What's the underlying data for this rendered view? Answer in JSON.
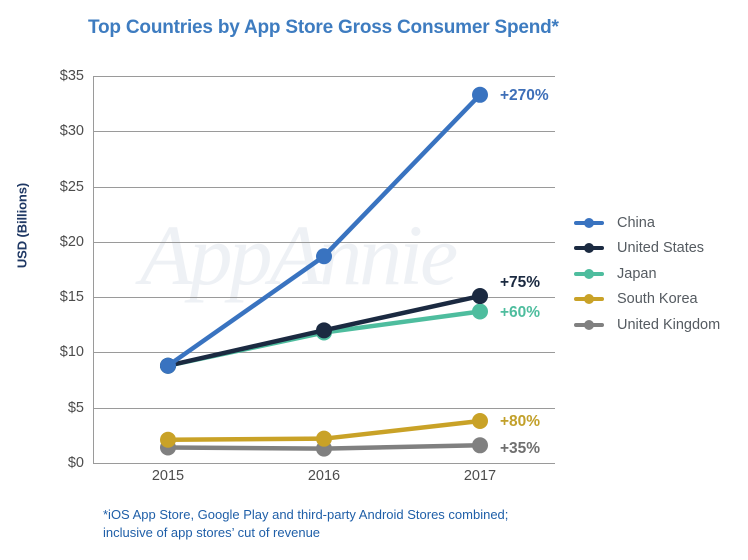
{
  "chart_data": {
    "type": "line",
    "title": "Top Countries by App Store Gross Consumer Spend*",
    "xlabel": "",
    "ylabel": "USD (Billions)",
    "categories": [
      "2015",
      "2016",
      "2017"
    ],
    "x": [
      2015,
      2016,
      2017
    ],
    "ylim": [
      0,
      35
    ],
    "y_ticks": [
      "$0",
      "$5",
      "$10",
      "$15",
      "$20",
      "$25",
      "$30",
      "$35"
    ],
    "y_tick_values": [
      0,
      5,
      10,
      15,
      20,
      25,
      30,
      35
    ],
    "grid": true,
    "legend_position": "right",
    "series": [
      {
        "name": "China",
        "color": "#3973c0",
        "values": [
          8.8,
          18.7,
          33.3
        ],
        "annotation": "+270%",
        "annotation_color": "#3e6fb8"
      },
      {
        "name": "United States",
        "color": "#1b2a41",
        "values": [
          8.8,
          12.0,
          15.1
        ],
        "annotation": "+75%",
        "annotation_color": "#1b2a41"
      },
      {
        "name": "Japan",
        "color": "#4ebd9e",
        "values": [
          8.8,
          11.8,
          13.7
        ],
        "annotation": "+60%",
        "annotation_color": "#4ebd9e"
      },
      {
        "name": "South Korea",
        "color": "#c9a227",
        "values": [
          2.1,
          2.2,
          3.8
        ],
        "annotation": "+80%",
        "annotation_color": "#c2a02a"
      },
      {
        "name": "United Kingdom",
        "color": "#808080",
        "values": [
          1.4,
          1.3,
          1.6
        ],
        "annotation": "+35%",
        "annotation_color": "#6f6f6f"
      }
    ]
  },
  "watermark": "AppAnnie",
  "footnote": {
    "line1": "*iOS App Store, Google Play and third-party Android Stores combined;",
    "line2": "inclusive of app stores’ cut of revenue"
  }
}
